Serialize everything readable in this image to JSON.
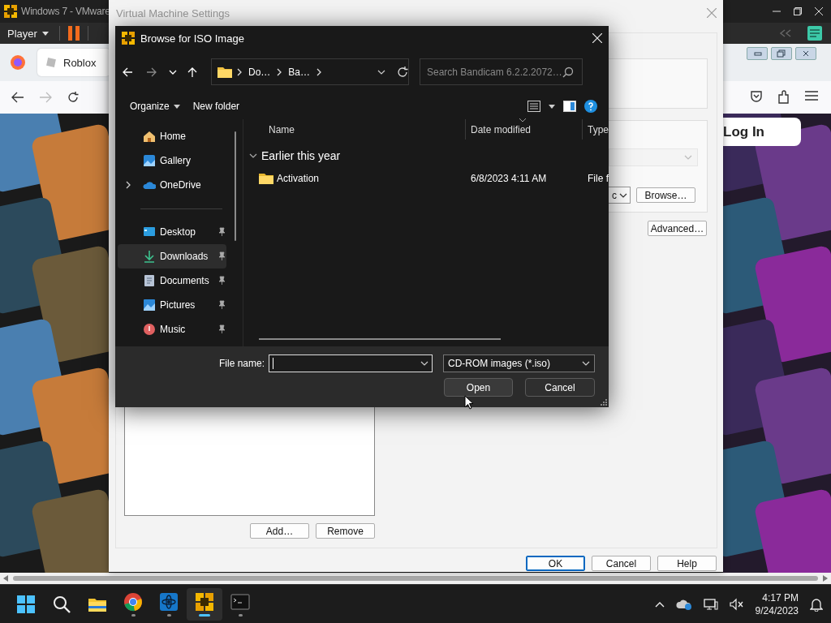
{
  "host_window": {
    "title": "Windows 7 - VMware",
    "menu": "Player"
  },
  "browser": {
    "tab": "Roblox",
    "login_button": "Log In"
  },
  "vm_settings": {
    "title": "Virtual Machine Settings",
    "list_buttons": [
      "Add…",
      "Remove"
    ],
    "combo_value": "c",
    "browse_button": "Browse…",
    "advanced_button": "Advanced…",
    "buttons": [
      {
        "label": "OK",
        "default": true
      },
      {
        "label": "Cancel",
        "default": false
      },
      {
        "label": "Help",
        "default": false
      }
    ]
  },
  "dialog": {
    "title": "Browse for ISO Image",
    "breadcrumb": [
      "Do…",
      "Ba…"
    ],
    "search_placeholder": "Search Bandicam 6.2.2.2072…",
    "commands": [
      "Organize",
      "New folder"
    ],
    "nav_sections": [
      {
        "items": [
          {
            "label": "Home",
            "kind": "home",
            "expandable": false,
            "pinned": false,
            "selected": false
          },
          {
            "label": "Gallery",
            "kind": "gallery",
            "expandable": false,
            "pinned": false,
            "selected": false
          },
          {
            "label": "OneDrive",
            "kind": "onedrive",
            "expandable": true,
            "pinned": false,
            "selected": false
          }
        ]
      },
      {
        "items": [
          {
            "label": "Desktop",
            "kind": "desktop",
            "expandable": false,
            "pinned": true,
            "selected": false
          },
          {
            "label": "Downloads",
            "kind": "downloads",
            "expandable": false,
            "pinned": true,
            "selected": true
          },
          {
            "label": "Documents",
            "kind": "documents",
            "expandable": false,
            "pinned": true,
            "selected": false
          },
          {
            "label": "Pictures",
            "kind": "pictures",
            "expandable": false,
            "pinned": true,
            "selected": false
          },
          {
            "label": "Music",
            "kind": "music",
            "expandable": false,
            "pinned": true,
            "selected": false
          }
        ]
      }
    ],
    "columns": [
      "Name",
      "Date modified",
      "Type"
    ],
    "groups": [
      {
        "label": "Earlier this year",
        "expanded": true,
        "files": [
          {
            "name": "Activation",
            "date_modified": "6/8/2023 4:11 AM",
            "type": "File f"
          }
        ]
      }
    ],
    "file_name_label": "File name:",
    "file_type": "CD-ROM images (*.iso)",
    "buttons": [
      "Open",
      "Cancel"
    ]
  },
  "taskbar": {
    "apps": [
      {
        "kind": "start",
        "active": false
      },
      {
        "kind": "search",
        "active": false
      },
      {
        "kind": "explorer",
        "active": false
      },
      {
        "kind": "chrome",
        "active": false
      },
      {
        "kind": "app",
        "active": false
      },
      {
        "kind": "vmware",
        "active": true
      },
      {
        "kind": "terminal",
        "active": false
      }
    ],
    "time": "4:17 PM",
    "date": "9/24/2023"
  }
}
